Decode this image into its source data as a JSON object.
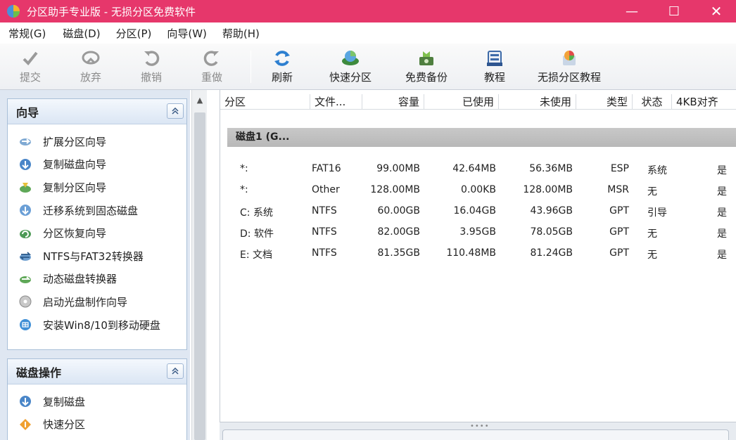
{
  "window": {
    "title": "分区助手专业版 - 无损分区免费软件",
    "minimize": "—",
    "maximize": "☐",
    "close": "✕"
  },
  "menu": [
    "常规(G)",
    "磁盘(D)",
    "分区(P)",
    "向导(W)",
    "帮助(H)"
  ],
  "toolbar": [
    {
      "label": "提交",
      "icon": "check-icon",
      "enabled": false
    },
    {
      "label": "放弃",
      "icon": "discard-icon",
      "enabled": false
    },
    {
      "label": "撤销",
      "icon": "undo-icon",
      "enabled": false
    },
    {
      "label": "重做",
      "icon": "redo-icon",
      "enabled": false
    },
    {
      "label": "刷新",
      "icon": "refresh-icon",
      "enabled": true
    },
    {
      "label": "快速分区",
      "icon": "quick-partition-icon",
      "enabled": true
    },
    {
      "label": "免费备份",
      "icon": "backup-icon",
      "enabled": true
    },
    {
      "label": "教程",
      "icon": "tutorial-icon",
      "enabled": true
    },
    {
      "label": "无损分区教程",
      "icon": "lossless-tutorial-icon",
      "enabled": true
    }
  ],
  "wizard_group": {
    "title": "向导",
    "items": [
      "扩展分区向导",
      "复制磁盘向导",
      "复制分区向导",
      "迁移系统到固态磁盘",
      "分区恢复向导",
      "NTFS与FAT32转换器",
      "动态磁盘转换器",
      "启动光盘制作向导",
      "安装Win8/10到移动硬盘"
    ]
  },
  "disk_group": {
    "title": "磁盘操作",
    "items": [
      "复制磁盘",
      "快速分区"
    ]
  },
  "columns": [
    "分区",
    "文件...",
    "容量",
    "已使用",
    "未使用",
    "类型",
    "状态",
    "4KB对齐"
  ],
  "disk": {
    "label": "磁盘1 (G..."
  },
  "partitions": [
    {
      "name": "*:",
      "fs": "FAT16",
      "capacity": "99.00MB",
      "used": "42.64MB",
      "free": "56.36MB",
      "type": "ESP",
      "status": "系统",
      "aligned": "是"
    },
    {
      "name": "*:",
      "fs": "Other",
      "capacity": "128.00MB",
      "used": "0.00KB",
      "free": "128.00MB",
      "type": "MSR",
      "status": "无",
      "aligned": "是"
    },
    {
      "name": "C: 系统",
      "fs": "NTFS",
      "capacity": "60.00GB",
      "used": "16.04GB",
      "free": "43.96GB",
      "type": "GPT",
      "status": "引导",
      "aligned": "是"
    },
    {
      "name": "D: 软件",
      "fs": "NTFS",
      "capacity": "82.00GB",
      "used": "3.95GB",
      "free": "78.05GB",
      "type": "GPT",
      "status": "无",
      "aligned": "是"
    },
    {
      "name": "E: 文档",
      "fs": "NTFS",
      "capacity": "81.35GB",
      "used": "110.48MB",
      "free": "81.24GB",
      "type": "GPT",
      "status": "无",
      "aligned": "是"
    }
  ],
  "colors": {
    "titlebar": "#e6376b",
    "panel": "#dfe7f2",
    "disk_header": "#c0c0c0"
  }
}
